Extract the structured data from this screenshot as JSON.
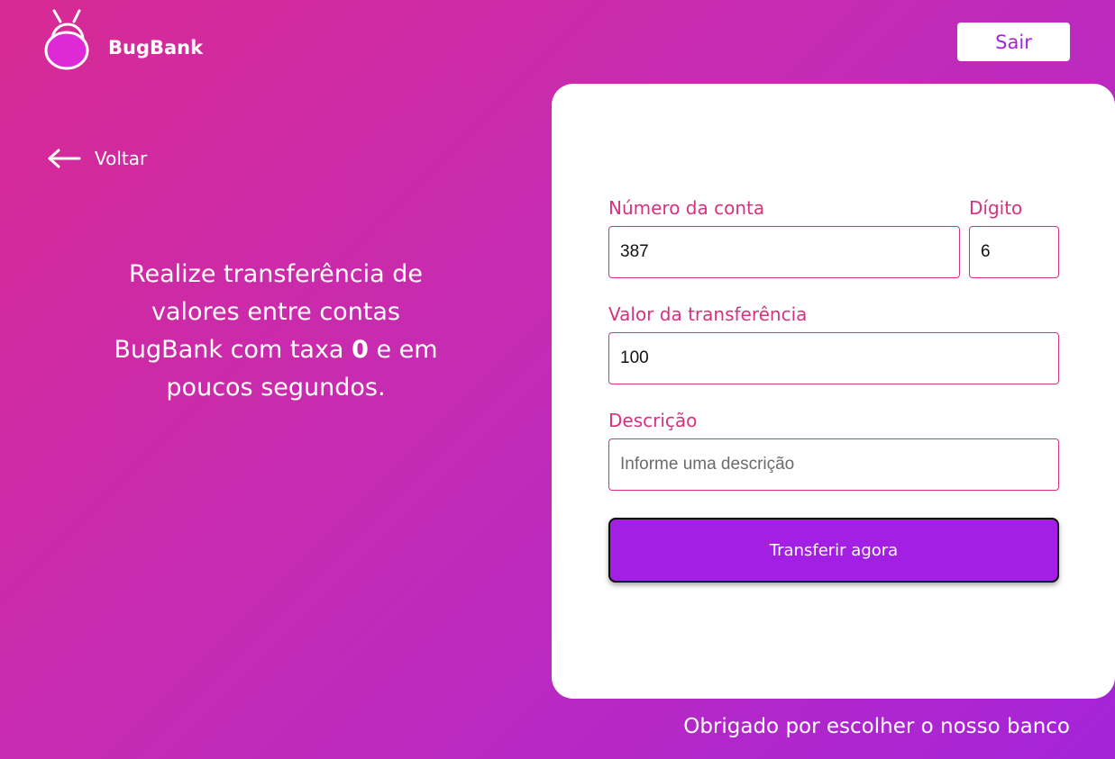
{
  "brand": {
    "name": "BugBank",
    "logo_icon": "bug-icon"
  },
  "header": {
    "logout_label": "Sair"
  },
  "nav": {
    "back_label": "Voltar",
    "back_icon": "arrow-left-icon"
  },
  "tagline": {
    "part1": "Realize transferência de valores entre contas BugBank com taxa ",
    "highlight": "0",
    "part2": " e em poucos segundos."
  },
  "form": {
    "account_label": "Número da conta",
    "account_value": "387",
    "digit_label": "Dígito",
    "digit_value": "6",
    "amount_label": "Valor da transferência",
    "amount_value": "100",
    "description_label": "Descrição",
    "description_value": "",
    "description_placeholder": "Informe uma descrição",
    "submit_label": "Transferir agora"
  },
  "footer": {
    "message": "Obrigado por escolher o nosso banco"
  },
  "colors": {
    "accent": "#a21fe3",
    "label_pink": "#d5327f",
    "gradient_start": "#d82a94",
    "gradient_end": "#a524d9"
  }
}
